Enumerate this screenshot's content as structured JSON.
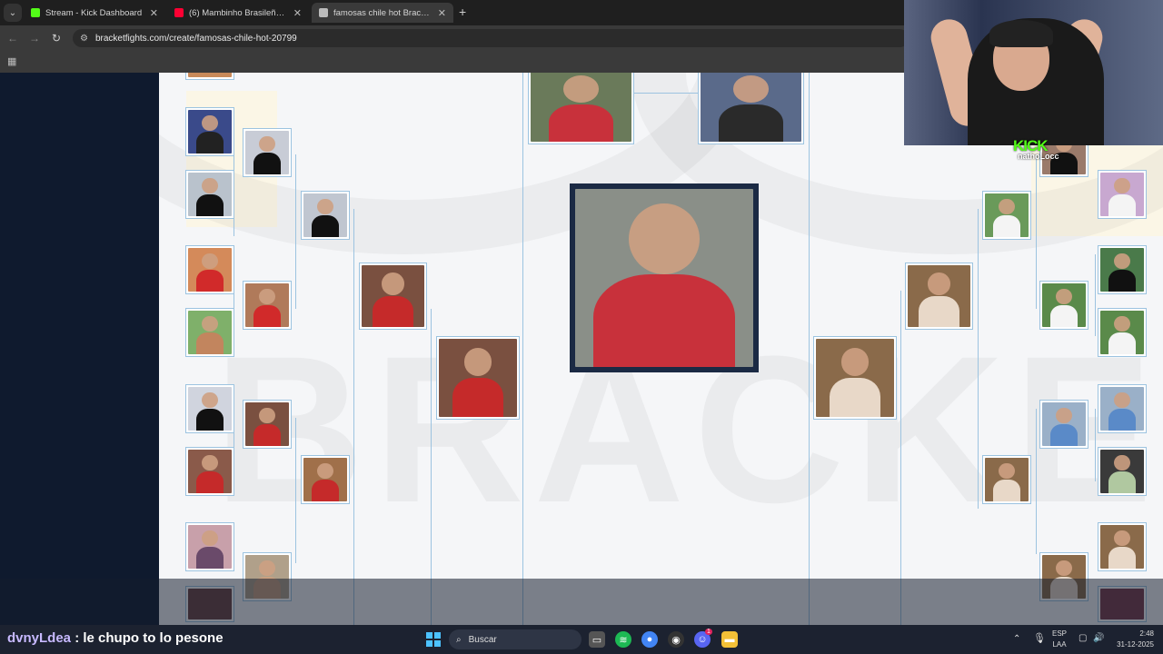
{
  "browser": {
    "tabs": [
      {
        "title": "Stream - Kick Dashboard",
        "favicon_color": "#53fc18",
        "active": false
      },
      {
        "title": "(6) Mambinho Brasileño / benji",
        "favicon_color": "#ff0033",
        "active": false
      },
      {
        "title": "famosas chile hot Bracket - Bra",
        "favicon_color": "#bbbbbb",
        "active": true
      }
    ],
    "new_tab": "+",
    "url": "bracketfights.com/create/famosas-chile-hot-20799",
    "back": "←",
    "forward": "→",
    "reload": "↻"
  },
  "bracket": {
    "watermark": "BRACKET",
    "line_color": "#9cc3e0",
    "champion": {
      "photo_color": "#c8313b"
    }
  },
  "overlay": {
    "kick_logo": "KICK",
    "handle": "nathoLocc"
  },
  "chat": {
    "username": "dvnyLdea",
    "separator": ":",
    "message": "le chupo to lo pesone"
  },
  "taskbar": {
    "search_placeholder": "Buscar",
    "language": "ESP",
    "layout": "LAA",
    "time": "2:48",
    "date": "31-12-2025",
    "notification_count": "1"
  }
}
